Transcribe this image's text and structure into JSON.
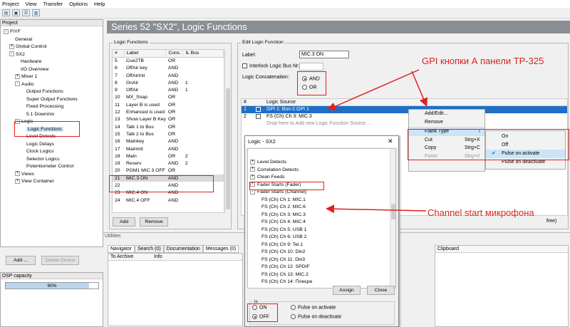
{
  "menu": [
    "Project",
    "View",
    "Transfer",
    "Options",
    "Help"
  ],
  "left": {
    "header": "Project",
    "tree": [
      {
        "label": "FIYF",
        "exp": "-",
        "indent": 0
      },
      {
        "label": "General",
        "exp": "",
        "indent": 2
      },
      {
        "label": "Global Control",
        "exp": "+",
        "indent": 1
      },
      {
        "label": "SX2",
        "exp": "-",
        "indent": 1
      },
      {
        "label": "Hardware",
        "exp": "",
        "indent": 3
      },
      {
        "label": "I/O Overview",
        "exp": "",
        "indent": 3
      },
      {
        "label": "Mixer 1",
        "exp": "+",
        "indent": 2
      },
      {
        "label": "Audio",
        "exp": "-",
        "indent": 2
      },
      {
        "label": "Output Functions",
        "exp": "",
        "indent": 4
      },
      {
        "label": "Super Output Functions",
        "exp": "",
        "indent": 4
      },
      {
        "label": "Fixed Processing",
        "exp": "",
        "indent": 4
      },
      {
        "label": "5.1 Downmix",
        "exp": "",
        "indent": 4
      },
      {
        "label": "Logic",
        "exp": "-",
        "indent": 2
      },
      {
        "label": "Logic Functions",
        "exp": "",
        "indent": 4,
        "selected": true
      },
      {
        "label": "Level Detects",
        "exp": "",
        "indent": 4
      },
      {
        "label": "Logic Delays",
        "exp": "",
        "indent": 4
      },
      {
        "label": "Clock Logics",
        "exp": "",
        "indent": 4
      },
      {
        "label": "Selector Logics",
        "exp": "",
        "indent": 4
      },
      {
        "label": "Potentiometer Control",
        "exp": "",
        "indent": 4
      },
      {
        "label": "Views",
        "exp": "+",
        "indent": 2
      },
      {
        "label": "View Container",
        "exp": "+",
        "indent": 2
      }
    ],
    "add_btn": "Add ...",
    "delete_btn": "Delete Device",
    "dsp_header": "DSP capacity",
    "dsp_value": "90%",
    "dsp_fraction": 0.9
  },
  "title": "Series 52 \"SX2\", Logic Functions",
  "logic_functions": {
    "header": "Logic Functions",
    "columns": [
      "#",
      "Label",
      "Conc.",
      "IL Bus"
    ],
    "rows": [
      [
        "5",
        "Cue2TB",
        "OR",
        ""
      ],
      [
        "6",
        "OffAir key",
        "AND",
        ""
      ],
      [
        "7",
        "OffAirInit",
        "AND",
        ""
      ],
      [
        "8",
        "OnAir",
        "AND",
        "1"
      ],
      [
        "9",
        "OffAir",
        "AND",
        "1"
      ],
      [
        "10",
        "MX_Snap",
        "OR",
        ""
      ],
      [
        "11",
        "Layer B is used",
        "OR",
        ""
      ],
      [
        "12",
        "Enhanced is used",
        "OR",
        ""
      ],
      [
        "13",
        "Show Layer B Key",
        "OR",
        ""
      ],
      [
        "14",
        "Talk 1 to Bus",
        "OR",
        ""
      ],
      [
        "15",
        "Talk 2 to Bus",
        "OR",
        ""
      ],
      [
        "16",
        "Mainkey",
        "AND",
        ""
      ],
      [
        "17",
        "MainInit",
        "AND",
        ""
      ],
      [
        "18",
        "Main",
        "OR",
        "2"
      ],
      [
        "19",
        "Reserv",
        "AND",
        "2"
      ],
      [
        "20",
        "PGM1 MIC 3 OFF",
        "OR",
        ""
      ],
      [
        "21",
        "MIC.3 ON",
        "AND",
        ""
      ],
      [
        "22",
        "",
        "AND",
        ""
      ],
      [
        "23",
        "MIC.4 ON",
        "AND",
        ""
      ],
      [
        "24",
        "MIC.4 OFF",
        "AND",
        ""
      ]
    ],
    "add_btn": "Add",
    "remove_btn": "Remove"
  },
  "edit": {
    "header": "Edit Logic Function",
    "label_caption": "Label:",
    "label_value": "MIC.3 ON",
    "interlock": "Interlock Logic Bus Nr:",
    "concat": "Logic Concatenation:",
    "and": "AND",
    "or": "OR",
    "src_cols": [
      "#",
      "Logic Source"
    ],
    "sources": [
      [
        "1",
        "GPI 1: Box-2.GPI 1"
      ],
      [
        "2",
        "FS (Ch) Ch 3: MIC.3"
      ]
    ],
    "drop": "Drop here to Add new Logic Function Source ...",
    "free": "free)"
  },
  "ctx": {
    "items": [
      "Add/Edit...",
      "Remove",
      "Flank Type",
      "Cut",
      "Copy",
      "Paste"
    ],
    "cut_key": "Strg+X",
    "copy_key": "Strg+C",
    "paste_key": "Strg+V"
  },
  "flank": {
    "items": [
      "On",
      "Off",
      "Pulse on activate",
      "Pulse on deactivate"
    ]
  },
  "annotations": {
    "gpi": "GPI кнопки А панели TP-325",
    "channel": "Channel start микрофона"
  },
  "dialog": {
    "title": "Logic - SX2",
    "items": [
      {
        "t": "Level Detects",
        "e": "+",
        "i": 0
      },
      {
        "t": "Correlation Detects",
        "e": "+",
        "i": 0
      },
      {
        "t": "Clean Feeds",
        "e": "+",
        "i": 0
      },
      {
        "t": "Fader Starts (Fader)",
        "e": "+",
        "i": 0
      },
      {
        "t": "Fader Starts (Channel)",
        "e": "-",
        "i": 0
      },
      {
        "t": "FS (Ch) Ch 1: MIC.1",
        "e": "",
        "i": 1
      },
      {
        "t": "FS (Ch) Ch 2: MIC.6",
        "e": "",
        "i": 1
      },
      {
        "t": "FS (Ch) Ch 3: MIC.3",
        "e": "",
        "i": 1
      },
      {
        "t": "FS (Ch) Ch 4: MIC.4",
        "e": "",
        "i": 1
      },
      {
        "t": "FS (Ch) Ch 5: USB 1",
        "e": "",
        "i": 1
      },
      {
        "t": "FS (Ch) Ch 6: USB 2",
        "e": "",
        "i": 1
      },
      {
        "t": "FS (Ch) Ch 9: Tel.1",
        "e": "",
        "i": 1
      },
      {
        "t": "FS (Ch) Ch 10: Din2",
        "e": "",
        "i": 1
      },
      {
        "t": "FS (Ch) Ch 11: Din3",
        "e": "",
        "i": 1
      },
      {
        "t": "FS (Ch) Ch 12: SPDIF",
        "e": "",
        "i": 1
      },
      {
        "t": "FS (Ch) Ch 13: MIC.2",
        "e": "",
        "i": 1
      },
      {
        "t": "FS (Ch) Ch 14: Плеєре",
        "e": "",
        "i": 1
      }
    ],
    "assign": "Assign",
    "close": "Close",
    "is": "is",
    "on": "ON",
    "off": "OFF",
    "pulse_act": "Pulse on activate",
    "pulse_deact": "Pulse on deactivate"
  },
  "utilities": {
    "header": "Utilities",
    "tabs": [
      "Navigator",
      "Search (0)",
      "Documentation",
      "Messages (0)"
    ],
    "cols": [
      "To Archive",
      "Info"
    ],
    "clipboard": "Clipboard"
  }
}
